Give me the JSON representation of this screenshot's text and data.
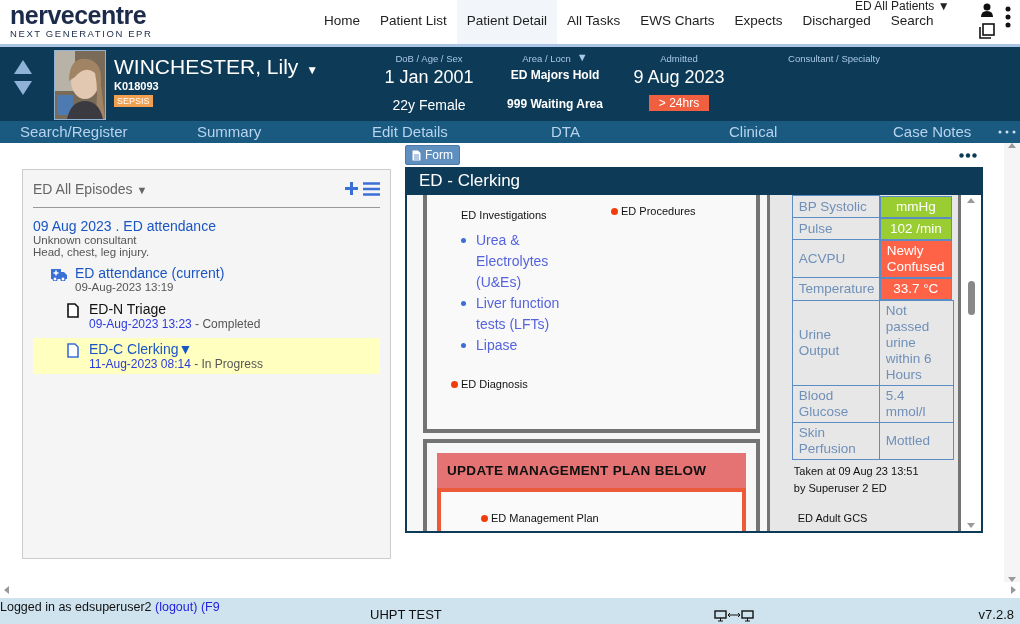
{
  "header": {
    "logo": "nervecentre",
    "tagline": "NEXT GENERATION EPR",
    "ward_filter": "ED All Patients ▼",
    "nav": [
      {
        "label": "Home",
        "selected": false
      },
      {
        "label": "Patient List",
        "selected": false
      },
      {
        "label": "Patient Detail",
        "selected": true
      },
      {
        "label": "All Tasks",
        "selected": false
      },
      {
        "label": "EWS Charts",
        "selected": false
      },
      {
        "label": "Expects",
        "selected": false
      },
      {
        "label": "Discharged",
        "selected": false
      },
      {
        "label": "Search",
        "selected": false
      }
    ]
  },
  "patient": {
    "name": "WINCHESTER, Lily",
    "name_caret": "▼",
    "mrn": "K018093",
    "alert": "SEPSIS",
    "dob_label": "DoB / Age / Sex",
    "dob": "1 Jan 2001",
    "age_sex": "22y Female",
    "area_label": "Area / Locn",
    "area_caret": "▼",
    "area": "ED Majors Hold",
    "location": "999 Waiting Area",
    "admitted_label": "Admitted",
    "admitted": "9 Aug 2023",
    "stay": "> 24hrs",
    "consultant_label": "Consultant / Specialty"
  },
  "tabs": [
    "Search/Register",
    "Summary",
    "Edit Details",
    "DTA",
    "Clinical",
    "Case Notes"
  ],
  "episodes": {
    "title": "ED All Episodes",
    "caret": "▼",
    "episode": {
      "title": "09 Aug 2023 . ED attendance",
      "consultant": "Unknown consultant",
      "complaint": "Head, chest, leg injury."
    },
    "attendance": {
      "title": "ED attendance (current)",
      "time": "09-Aug-2023 13:19"
    },
    "forms": [
      {
        "title": "ED-N Triage",
        "time": "09-Aug-2023 13:23",
        "status": "- Completed",
        "selected": false
      },
      {
        "title": "ED-C Clerking▼",
        "time": "11-Aug-2023 08:14",
        "status": "- In Progress",
        "selected": true
      }
    ]
  },
  "form_button": "Form",
  "form": {
    "title": "ED - Clerking",
    "investigations_title": "ED Investigations",
    "investigations": [
      "Urea & Electrolytes (U&Es)",
      "Liver function tests (LFTs)",
      "Lipase"
    ],
    "procedures": "ED Procedures",
    "diagnosis": "ED Diagnosis",
    "plan_banner": "UPDATE MANAGEMENT PLAN BELOW",
    "plan_item": "ED Management Plan"
  },
  "vitals": {
    "rows": [
      {
        "label": "BP Systolic",
        "value": "mmHg",
        "color": "#9acd32"
      },
      {
        "label": "Pulse",
        "value": "102 /min",
        "color": "#9acd32"
      },
      {
        "label": "ACVPU",
        "value": "Newly Confused",
        "color": "#ff6347"
      },
      {
        "label": "Temperature",
        "value": "33.7 °C",
        "color": "#ff6347"
      },
      {
        "label": "Urine Output",
        "value": "Not passed urine within 6 Hours"
      },
      {
        "label": "Blood Glucose",
        "value": "5.4 mmol/l"
      },
      {
        "label": "Skin Perfusion",
        "value": "Mottled"
      }
    ],
    "taken": "Taken at 09 Aug 23 13:51",
    "by": "by Superuser 2 ED",
    "next": "ED Adult GCS"
  },
  "status_bar": {
    "login": "Logged in as edsuperuser2",
    "logout": "(logout)",
    "lock": "(F9",
    "env": "UHPT TEST",
    "version": "v7.2.8"
  }
}
